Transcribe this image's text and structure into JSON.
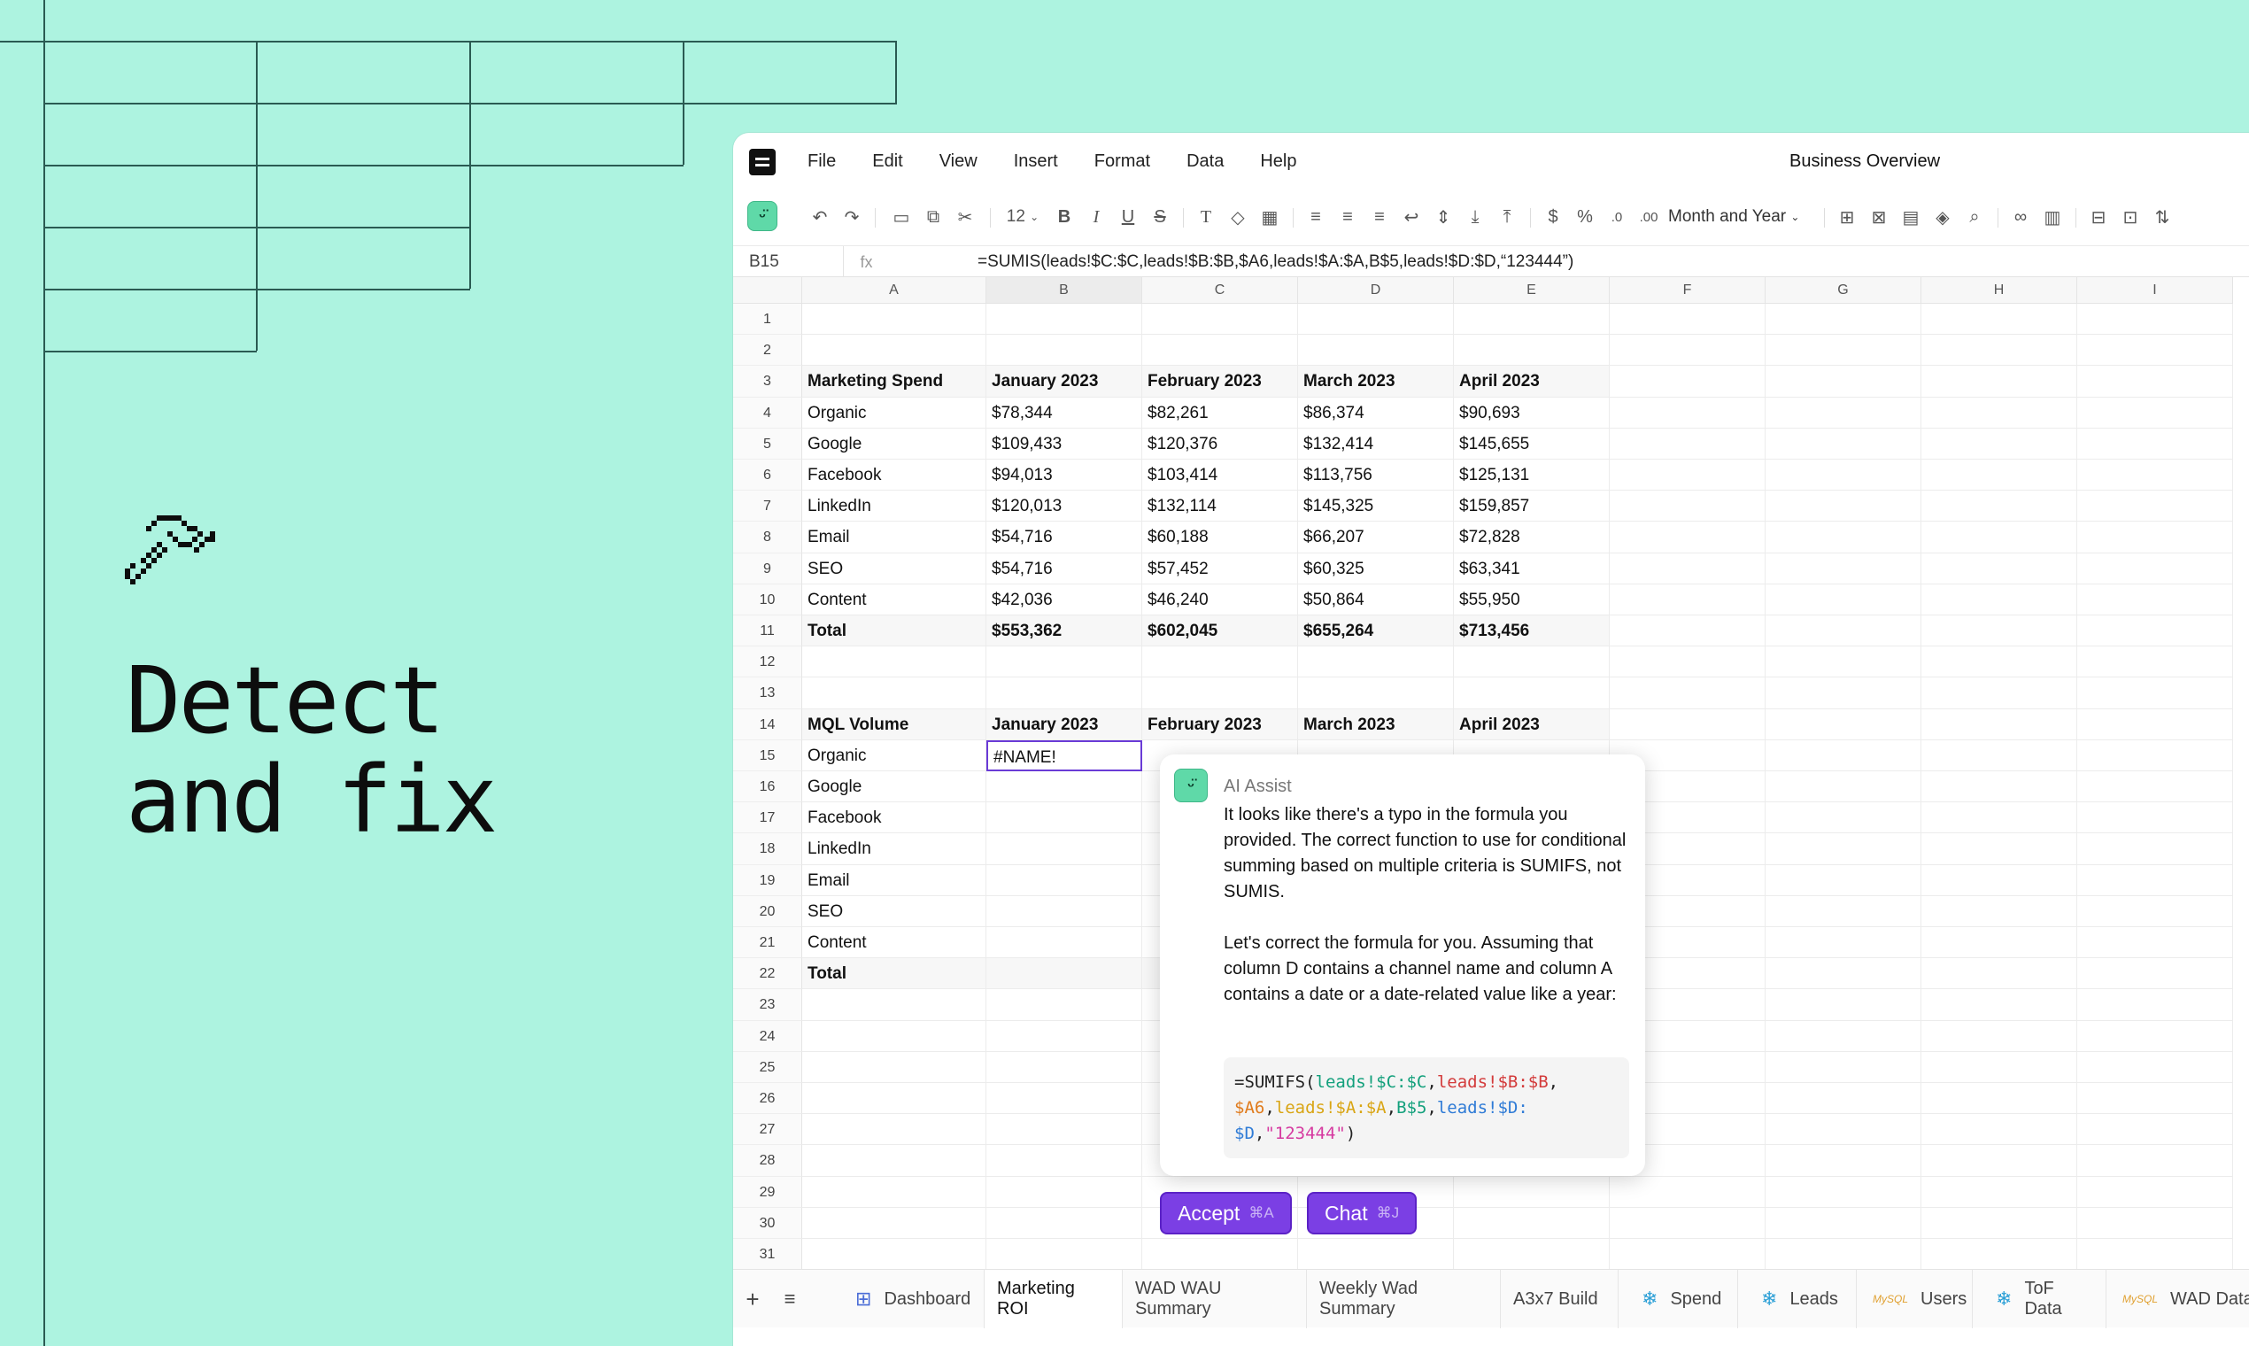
{
  "hero": {
    "title_line1": "Detect",
    "title_line2": "and fix"
  },
  "menubar": {
    "items": [
      "File",
      "Edit",
      "View",
      "Insert",
      "Format",
      "Data",
      "Help"
    ],
    "doc_title": "Business Overview"
  },
  "toolbar": {
    "font_size": "12",
    "number_format": "Month and Year"
  },
  "formula_bar": {
    "cell_ref": "B15",
    "fx_label": "fx",
    "formula": "=SUMIS(leads!$C:$C,leads!$B:$B,$A6,leads!$A:$A,B$5,leads!$D:$D,“123444”)"
  },
  "columns": [
    "A",
    "B",
    "C",
    "D",
    "E",
    "F",
    "G",
    "H",
    "I"
  ],
  "rows": [
    "1",
    "2",
    "3",
    "4",
    "5",
    "6",
    "7",
    "8",
    "9",
    "10",
    "11",
    "12",
    "13",
    "14",
    "15",
    "16",
    "17",
    "18",
    "19",
    "20",
    "21",
    "22",
    "23",
    "24",
    "25",
    "26",
    "27",
    "28",
    "29",
    "30",
    "31"
  ],
  "table1": {
    "header": [
      "Marketing Spend",
      "January 2023",
      "February 2023",
      "March 2023",
      "April 2023"
    ],
    "rows": [
      [
        "Organic",
        "$78,344",
        "$82,261",
        "$86,374",
        "$90,693"
      ],
      [
        "Google",
        "$109,433",
        "$120,376",
        "$132,414",
        "$145,655"
      ],
      [
        "Facebook",
        "$94,013",
        "$103,414",
        "$113,756",
        "$125,131"
      ],
      [
        "LinkedIn",
        "$120,013",
        "$132,114",
        "$145,325",
        "$159,857"
      ],
      [
        "Email",
        "$54,716",
        "$60,188",
        "$66,207",
        "$72,828"
      ],
      [
        "SEO",
        "$54,716",
        "$57,452",
        "$60,325",
        "$63,341"
      ],
      [
        "Content",
        "$42,036",
        "$46,240",
        "$50,864",
        "$55,950"
      ]
    ],
    "total": [
      "Total",
      "$553,362",
      "$602,045",
      "$655,264",
      "$713,456"
    ]
  },
  "table2": {
    "header": [
      "MQL Volume",
      "January 2023",
      "February 2023",
      "March 2023",
      "April 2023"
    ],
    "rows": [
      "Organic",
      "Google",
      "Facebook",
      "LinkedIn",
      "Email",
      "SEO",
      "Content"
    ],
    "total": "Total",
    "error_value": "#NAME!"
  },
  "ai_assist": {
    "title": "AI Assist",
    "para1": "It looks like there's a typo in the formula you provided. The correct function to use for conditional summing based on multiple criteria is SUMIFS, not SUMIS.",
    "para2": "Let's correct the formula for you. Assuming that column D contains a channel name and column A contains a date or a date-related value like a year:",
    "code": {
      "p1": "=SUMIFS(",
      "p2": "leads!$C:$C",
      "p3": ",",
      "p4": "leads!$B:$B",
      "p5": ",",
      "p6": "$A6",
      "p7": ",",
      "p8": "leads!$A:$A",
      "p9": ",",
      "p10": "B$5",
      "p11": ",",
      "p12": "leads!$D:",
      "p13": "$D",
      "p14": ",",
      "p15": "\"123444\"",
      "p16": ")"
    }
  },
  "buttons": {
    "accept": "Accept",
    "accept_kbd": "⌘A",
    "chat": "Chat",
    "chat_kbd": "⌘J"
  },
  "tabs": [
    "Dashboard",
    "Marketing ROI",
    "WAD WAU Summary",
    "Weekly Wad Summary",
    "A3x7 Build",
    "Spend",
    "Leads",
    "Users",
    "ToF Data",
    "WAD Data"
  ],
  "tab_icon_label": "MySQL",
  "colors": {
    "background": "#adf3e0",
    "accent": "#7b3fe4",
    "ai_avatar": "#5fd9a8"
  }
}
